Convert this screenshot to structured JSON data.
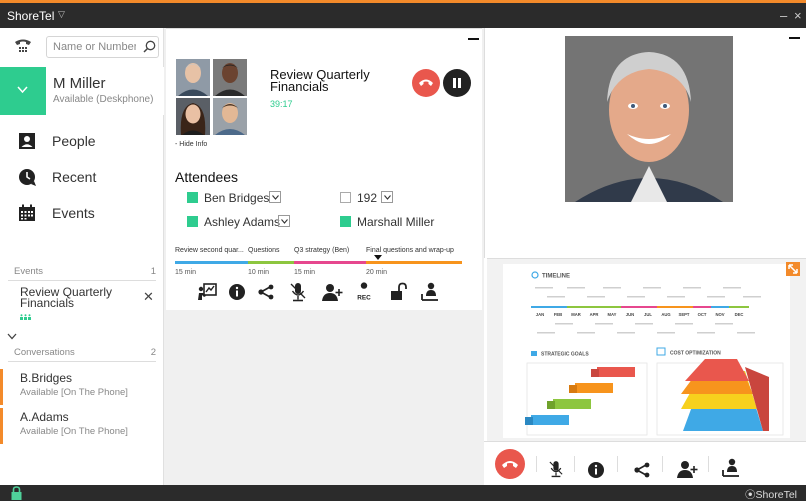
{
  "titlebar": {
    "app_name": "ShoreTel",
    "minimize_glyph": "–",
    "close_glyph": "×"
  },
  "search": {
    "placeholder": "Name or Number"
  },
  "user": {
    "name": "M Miller",
    "status": "Available (Deskphone)"
  },
  "nav": [
    {
      "label": "People",
      "icon": "people-icon"
    },
    {
      "label": "Recent",
      "icon": "recent-icon"
    },
    {
      "label": "Events",
      "icon": "calendar-icon"
    }
  ],
  "events_section": {
    "title": "Events",
    "count": "1"
  },
  "event": {
    "title": "Review Quarterly Financials"
  },
  "conversations_section": {
    "title": "Conversations",
    "count": "2"
  },
  "conversations": [
    {
      "name": "B.Bridges",
      "status": "Available [On The Phone]"
    },
    {
      "name": "A.Adams",
      "status": "Available [On The Phone]"
    }
  ],
  "call": {
    "title": "Review Quarterly Financials",
    "timer": "39:17",
    "hide_info": "- Hide Info",
    "attendees_heading": "Attendees",
    "attendees": [
      {
        "name": "Ben Bridges",
        "active": true,
        "dropdown": true
      },
      {
        "name": "192",
        "active": false,
        "dropdown": true
      },
      {
        "name": "Ashley Adams",
        "active": true,
        "dropdown": true
      },
      {
        "name": "Marshall Miller",
        "active": true,
        "dropdown": false
      }
    ],
    "agenda": [
      {
        "label": "Review second quar...",
        "duration": "15 min",
        "color": "#3fa9e6"
      },
      {
        "label": "Questions",
        "duration": "10 min",
        "color": "#8dc63f"
      },
      {
        "label": "Q3 strategy (Ben)",
        "duration": "15 min",
        "color": "#e6478e"
      },
      {
        "label": "Final questions and wrap-up",
        "duration": "20 min",
        "color": "#f7941d"
      }
    ],
    "rec_label": "REC"
  },
  "slide": {
    "timeline": "TIMELINE",
    "months": [
      "JAN",
      "FEB",
      "MAR",
      "APR",
      "MAY",
      "JUN",
      "JUL",
      "AUG",
      "SEPT",
      "OCT",
      "NOV",
      "DEC"
    ],
    "strategic_goals": "STRATEGIC GOALS",
    "cost_optimization": "COST OPTIMIZATION"
  },
  "footer": {
    "brand": "ShoreTel"
  },
  "colors": {
    "accent": "#2ecc8f",
    "orange": "#f38a2a",
    "end_call": "#e9574d",
    "dark": "#2b2b2b"
  }
}
